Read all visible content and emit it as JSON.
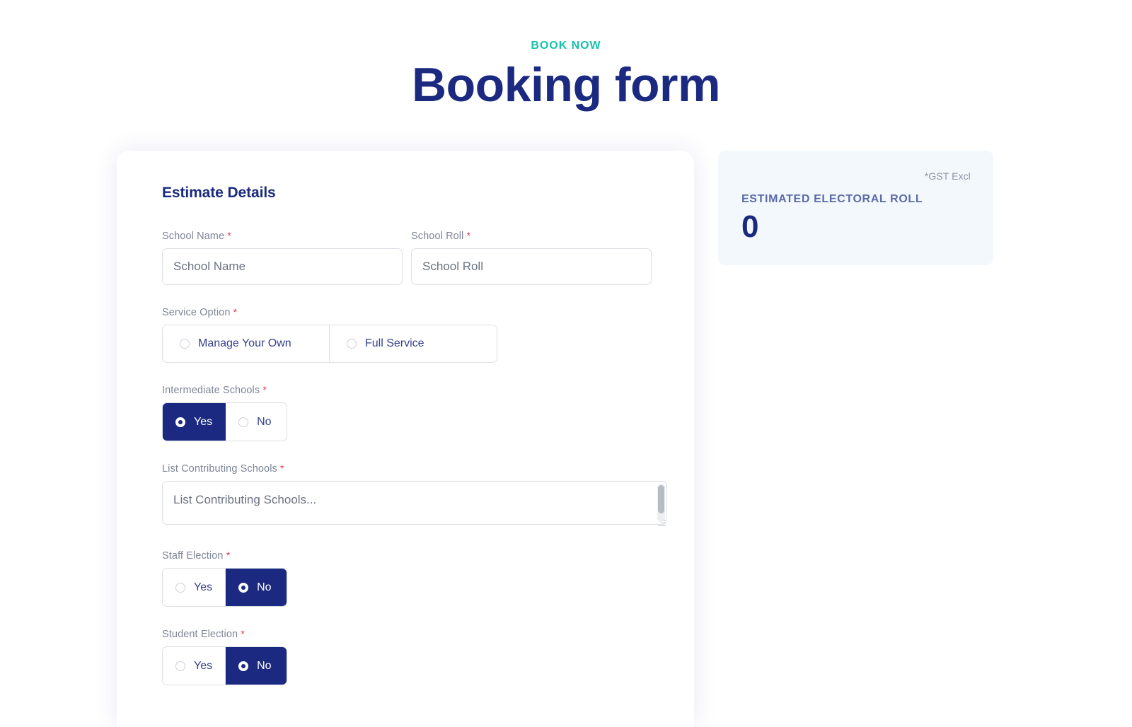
{
  "header": {
    "eyebrow": "BOOK NOW",
    "title": "Booking form"
  },
  "form": {
    "section_title": "Estimate Details",
    "required_marker": "*",
    "fields": {
      "school_name": {
        "label": "School Name",
        "placeholder": "School Name",
        "value": ""
      },
      "school_roll": {
        "label": "School Roll",
        "placeholder": "School Roll",
        "value": ""
      },
      "service_option": {
        "label": "Service Option",
        "options": [
          {
            "label": "Manage Your Own",
            "selected": false
          },
          {
            "label": "Full Service",
            "selected": false
          }
        ]
      },
      "intermediate_schools": {
        "label": "Intermediate Schools",
        "options": [
          {
            "label": "Yes",
            "selected": true
          },
          {
            "label": "No",
            "selected": false
          }
        ]
      },
      "list_contributing_schools": {
        "label": "List Contributing Schools",
        "placeholder": "List Contributing Schools...",
        "value": ""
      },
      "staff_election": {
        "label": "Staff Election",
        "options": [
          {
            "label": "Yes",
            "selected": false
          },
          {
            "label": "No",
            "selected": true
          }
        ]
      },
      "student_election": {
        "label": "Student Election",
        "options": [
          {
            "label": "Yes",
            "selected": false
          },
          {
            "label": "No",
            "selected": true
          }
        ]
      }
    }
  },
  "summary": {
    "gst_note": "*GST Excl",
    "label": "ESTIMATED ELECTORAL ROLL",
    "value": "0"
  },
  "colors": {
    "navy": "#1b2a80",
    "teal": "#17c0ae",
    "required_red": "#e8384f",
    "label_gray": "#7d8597",
    "summary_bg": "#f3f8fc",
    "summary_label": "#5c6ba8"
  }
}
